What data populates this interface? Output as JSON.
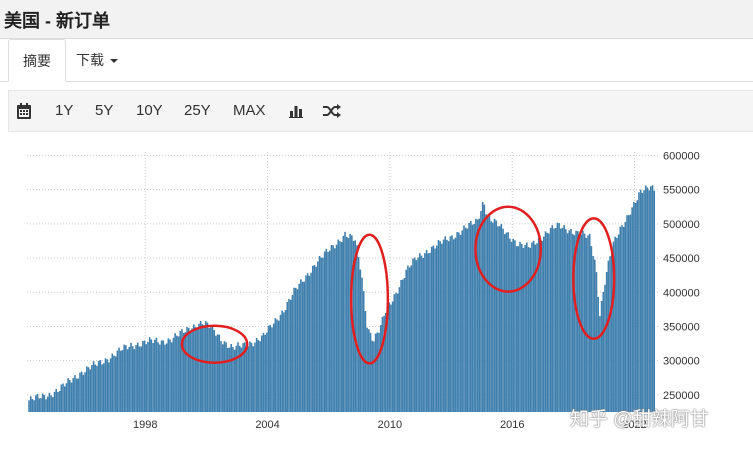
{
  "header": {
    "title": "美国 - 新订单"
  },
  "tabs": {
    "summary": "摘要",
    "download": "下载"
  },
  "toolbar": {
    "calendar_icon": "calendar-icon",
    "y1": "1Y",
    "y5": "5Y",
    "y10": "10Y",
    "y25": "25Y",
    "max": "MAX",
    "bar_icon": "bar-chart-icon",
    "shuffle_icon": "shuffle-icon"
  },
  "watermark": "知乎 @甜辣阿甘",
  "colors": {
    "bar": "#3f7fad",
    "annotation": "#e02020",
    "grid": "#cccccc"
  },
  "chart_data": {
    "type": "bar",
    "title": "",
    "xlabel": "",
    "ylabel": "",
    "x_range": [
      1992.2,
      2023.2
    ],
    "ylim": [
      225000,
      605000
    ],
    "y_ticks": [
      250000,
      300000,
      350000,
      400000,
      450000,
      500000,
      550000,
      600000
    ],
    "y_tick_labels": [
      "250000",
      "300000",
      "350000",
      "400000",
      "450000",
      "500000",
      "550000",
      "600000"
    ],
    "x_ticks": [
      1998,
      2004,
      2010,
      2016,
      2022
    ],
    "x_tick_labels": [
      "1998",
      "2004",
      "2010",
      "2016",
      "2022"
    ],
    "grid": true,
    "series": [
      {
        "x": [
          1992.3,
          1992.8,
          1993.3,
          1993.8,
          1994.3,
          1994.8,
          1995.3,
          1995.8,
          1996.3,
          1996.8,
          1997.3,
          1997.8,
          1998.3,
          1998.8,
          1999.3,
          1999.8,
          2000.3,
          2000.8,
          2001.3,
          2001.8,
          2002.3,
          2002.8,
          2003.3,
          2003.8,
          2004.3,
          2004.8,
          2005.3,
          2005.8,
          2006.3,
          2006.8,
          2007.3,
          2007.8,
          2008.3,
          2008.6,
          2008.9,
          2009.2,
          2009.5,
          2009.8,
          2010.3,
          2010.8,
          2011.3,
          2011.8,
          2012.3,
          2012.8,
          2013.3,
          2013.8,
          2014.3,
          2014.6,
          2014.8,
          2015.3,
          2015.8,
          2016.3,
          2016.8,
          2017.3,
          2017.8,
          2018.3,
          2018.8,
          2019.3,
          2019.8,
          2020.1,
          2020.3,
          2020.6,
          2020.9,
          2021.3,
          2021.8,
          2022.3,
          2022.8,
          2023.0
        ],
        "values": [
          242000,
          246000,
          251000,
          258000,
          270000,
          282000,
          290000,
          297000,
          306000,
          315000,
          322000,
          326000,
          328000,
          328000,
          332000,
          340000,
          350000,
          356000,
          346000,
          330000,
          318000,
          322000,
          328000,
          335000,
          355000,
          375000,
          400000,
          420000,
          440000,
          455000,
          470000,
          485000,
          475000,
          430000,
          350000,
          330000,
          345000,
          372000,
          400000,
          430000,
          450000,
          460000,
          468000,
          478000,
          486000,
          495000,
          505000,
          535000,
          510000,
          498000,
          485000,
          470000,
          465000,
          478000,
          490000,
          497000,
          492000,
          485000,
          480000,
          440000,
          370000,
          425000,
          465000,
          492000,
          520000,
          545000,
          555000,
          552000
        ]
      }
    ],
    "annotations": [
      {
        "type": "ellipse",
        "cx": 2001.4,
        "cy": 324000,
        "rx": 1.6,
        "ry": 27000
      },
      {
        "type": "ellipse",
        "cx": 2009.0,
        "cy": 390000,
        "rx": 0.9,
        "ry": 94000
      },
      {
        "type": "ellipse",
        "cx": 2015.8,
        "cy": 463000,
        "rx": 1.6,
        "ry": 62000
      },
      {
        "type": "ellipse",
        "cx": 2020.0,
        "cy": 420000,
        "rx": 1.0,
        "ry": 88000
      }
    ]
  }
}
